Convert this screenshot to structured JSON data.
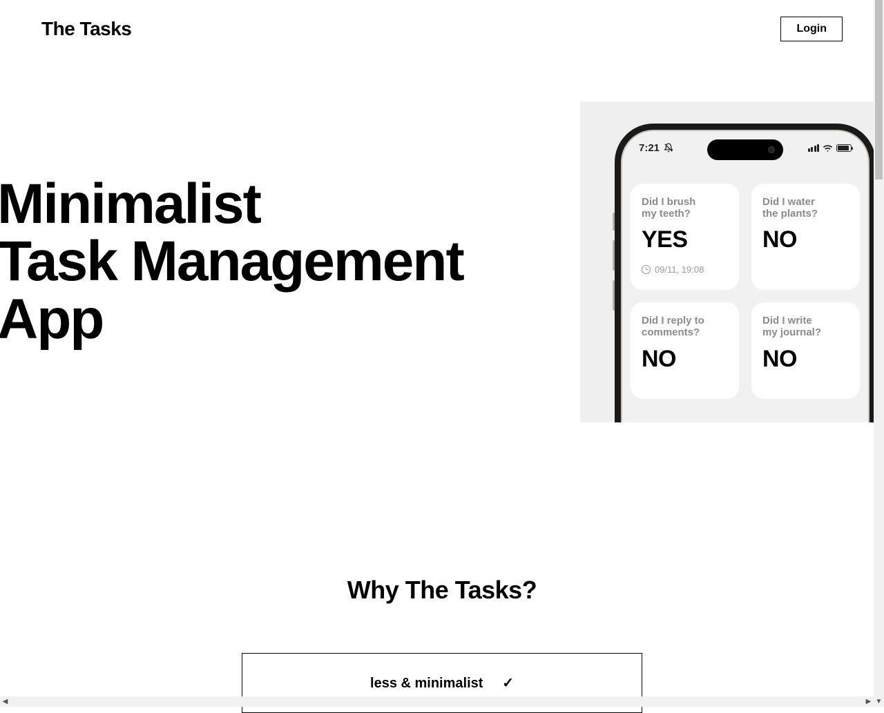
{
  "header": {
    "logo": "The Tasks",
    "login": "Login"
  },
  "hero": {
    "title_line1": "Minimalist",
    "title_line2": "Task Management",
    "title_line3": "App"
  },
  "phone": {
    "time": "7:21",
    "cards": [
      {
        "q_line1": "Did I brush",
        "q_line2": "my teeth?",
        "answer": "YES",
        "timestamp": "09/11, 19:08"
      },
      {
        "q_line1": "Did I water",
        "q_line2": "the plants?",
        "answer": "NO",
        "timestamp": ""
      },
      {
        "q_line1": "Did I reply to",
        "q_line2": "comments?",
        "answer": "NO",
        "timestamp": ""
      },
      {
        "q_line1": "Did I write",
        "q_line2": "my journal?",
        "answer": "NO",
        "timestamp": ""
      }
    ]
  },
  "section2": {
    "heading": "Why The Tasks?",
    "box_partial": "less & minimalist     ✓"
  }
}
